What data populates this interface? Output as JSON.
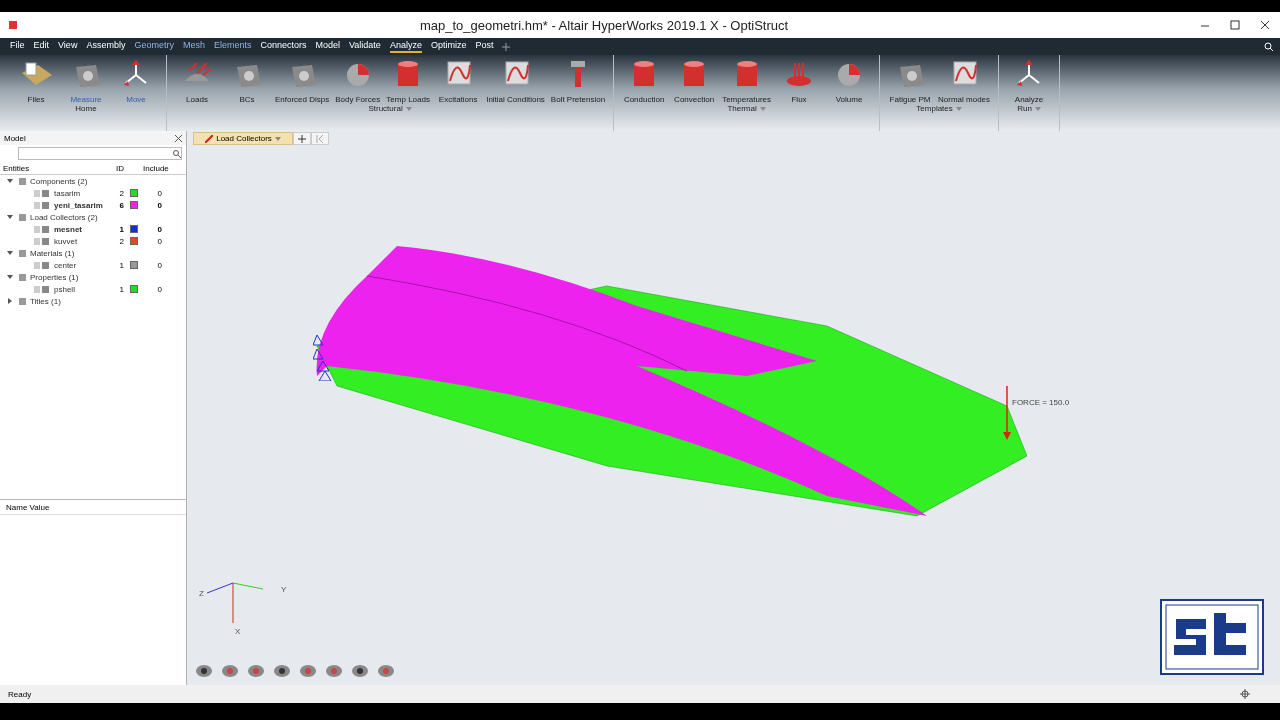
{
  "window": {
    "title": "map_to_geometri.hm* - Altair HyperWorks 2019.1 X - OptiStruct"
  },
  "menu": [
    {
      "label": "File",
      "selected": false,
      "highlighted": false
    },
    {
      "label": "Edit",
      "selected": false,
      "highlighted": false
    },
    {
      "label": "View",
      "selected": false,
      "highlighted": false
    },
    {
      "label": "Assembly",
      "selected": false,
      "highlighted": false
    },
    {
      "label": "Geometry",
      "selected": false,
      "highlighted": true
    },
    {
      "label": "Mesh",
      "selected": false,
      "highlighted": true
    },
    {
      "label": "Elements",
      "selected": false,
      "highlighted": true
    },
    {
      "label": "Connectors",
      "selected": false,
      "highlighted": false
    },
    {
      "label": "Model",
      "selected": false,
      "highlighted": false
    },
    {
      "label": "Validate",
      "selected": false,
      "highlighted": false
    },
    {
      "label": "Analyze",
      "selected": true,
      "highlighted": false
    },
    {
      "label": "Optimize",
      "selected": false,
      "highlighted": false
    },
    {
      "label": "Post",
      "selected": false,
      "highlighted": false
    }
  ],
  "ribbon": [
    {
      "label": "Home",
      "dropdown": false,
      "tools": [
        {
          "label": "Files",
          "highlighted": false
        },
        {
          "label": "Measure",
          "highlighted": true
        },
        {
          "label": "Move",
          "highlighted": true
        }
      ]
    },
    {
      "label": "Structural",
      "dropdown": true,
      "tools": [
        {
          "label": "Loads",
          "highlighted": false
        },
        {
          "label": "BCs",
          "highlighted": false
        },
        {
          "label": "Enforced Disps",
          "highlighted": false
        },
        {
          "label": "Body Forces",
          "highlighted": false
        },
        {
          "label": "Temp Loads",
          "highlighted": false
        },
        {
          "label": "Excitations",
          "highlighted": false
        },
        {
          "label": "Initial Conditions",
          "highlighted": false
        },
        {
          "label": "Bolt Pretension",
          "highlighted": false
        }
      ]
    },
    {
      "label": "Thermal",
      "dropdown": true,
      "tools": [
        {
          "label": "Conduction",
          "highlighted": false
        },
        {
          "label": "Convection",
          "highlighted": false
        },
        {
          "label": "Temperatures",
          "highlighted": false
        },
        {
          "label": "Flux",
          "highlighted": false
        },
        {
          "label": "Volume",
          "highlighted": false
        }
      ]
    },
    {
      "label": "Templates",
      "dropdown": true,
      "tools": [
        {
          "label": "Fatigue PM",
          "highlighted": false
        },
        {
          "label": "Normal modes",
          "highlighted": false
        }
      ]
    },
    {
      "label": "Run",
      "dropdown": true,
      "tools": [
        {
          "label": "Analyze",
          "highlighted": false
        }
      ]
    }
  ],
  "model_panel": {
    "title": "Model",
    "columns": [
      "Entities",
      "ID",
      "Include"
    ],
    "tree": [
      {
        "label": "Components (2)",
        "expanded": true,
        "children": [
          {
            "label": "tasarim",
            "id": "2",
            "color": "#22dd22",
            "include": "0",
            "current": false
          },
          {
            "label": "yeni_tasarim",
            "id": "6",
            "color": "#ee22ee",
            "include": "0",
            "current": true
          }
        ]
      },
      {
        "label": "Load Collectors (2)",
        "expanded": true,
        "children": [
          {
            "label": "mesnet",
            "id": "1",
            "color": "#1133cc",
            "include": "0",
            "current": true
          },
          {
            "label": "kuvvet",
            "id": "2",
            "color": "#ee4422",
            "include": "0",
            "current": false
          }
        ]
      },
      {
        "label": "Materials (1)",
        "expanded": true,
        "children": [
          {
            "label": "center",
            "id": "1",
            "color": "#999999",
            "include": "0",
            "current": false
          }
        ]
      },
      {
        "label": "Properties (1)",
        "expanded": true,
        "children": [
          {
            "label": "pshell",
            "id": "1",
            "color": "#22dd22",
            "include": "0",
            "current": false
          }
        ]
      },
      {
        "label": "Titles (1)",
        "expanded": false
      }
    ],
    "details_header": "Name Value"
  },
  "viewport": {
    "collector_tab": "Load Collectors",
    "force_label": "FORCE = 150.0",
    "axes": [
      "Y",
      "Z",
      "X"
    ]
  },
  "status_bar": "Ready"
}
